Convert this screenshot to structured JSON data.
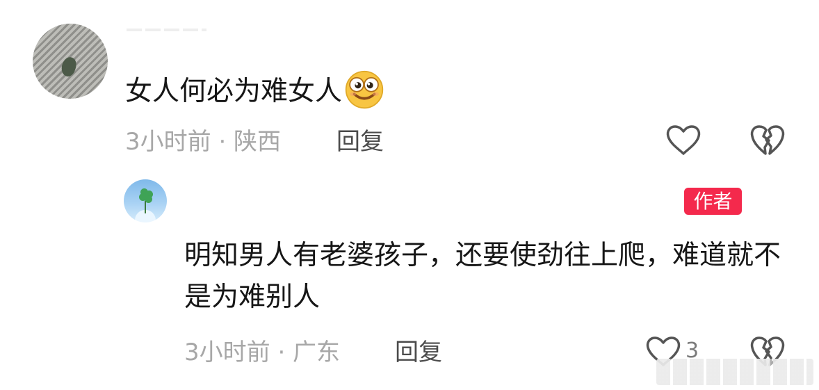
{
  "comment": {
    "text": "女人何必为难女人",
    "emoji_icon": "grinning-face-emoji-icon",
    "meta": "3小时前 · 陕西",
    "reply_label": "回复"
  },
  "reply": {
    "author_badge": "作者",
    "text": "明知男人有老婆孩子，还要使劲往上爬，难道就不是为难别人",
    "meta": "3小时前 · 广东",
    "reply_label": "回复",
    "like_count": "3"
  },
  "icons": {
    "like": "heart-outline-icon",
    "dislike": "broken-heart-icon"
  },
  "colors": {
    "text": "#161616",
    "meta": "#a7a7a7",
    "reply_action": "#4b4b4b",
    "badge_bg": "#f4294c",
    "icon_stroke": "#555555"
  }
}
